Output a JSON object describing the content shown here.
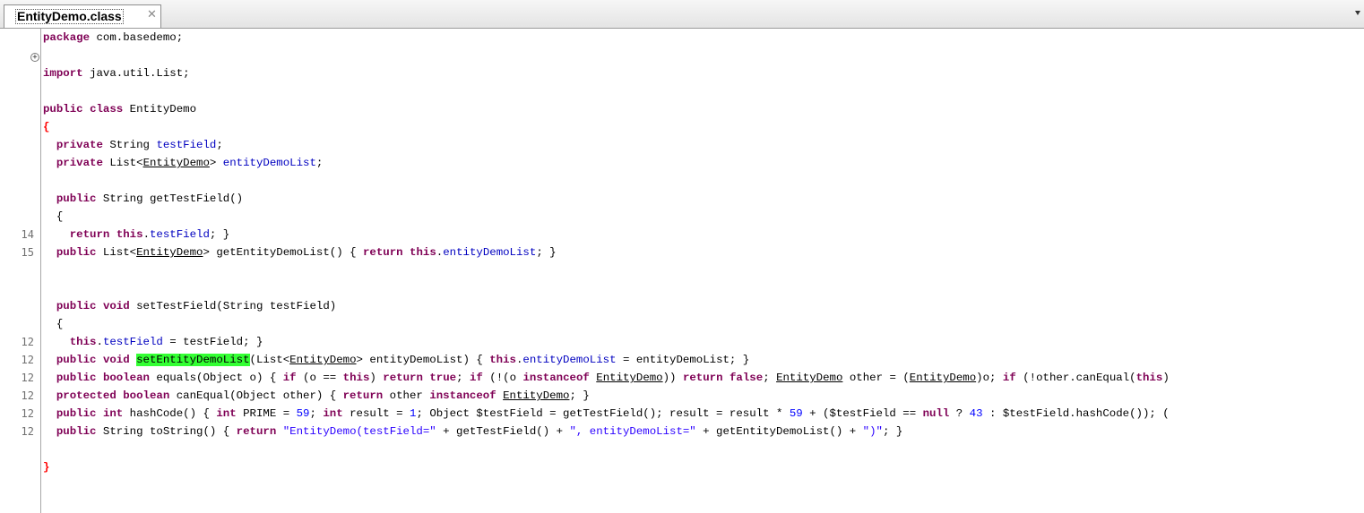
{
  "tab": {
    "title": "EntityDemo.class",
    "close_icon": "close-icon",
    "menu_icon": "dropdown-arrow-icon"
  },
  "gutter": {
    "line_numbers": [
      "14",
      "15",
      "12",
      "12",
      "12",
      "12",
      "12",
      "12"
    ]
  },
  "code": [
    [
      [
        "package",
        "kw"
      ],
      [
        " com.basedemo;",
        ""
      ]
    ],
    [],
    [
      [
        "import",
        "kw"
      ],
      [
        " java.util.List;",
        ""
      ]
    ],
    [],
    [
      [
        "public",
        "kw"
      ],
      [
        " ",
        ""
      ],
      [
        "class",
        "kw"
      ],
      [
        " EntityDemo",
        ""
      ]
    ],
    [
      [
        "{",
        "br"
      ]
    ],
    [
      [
        "  ",
        ""
      ],
      [
        "private",
        "kw"
      ],
      [
        " String ",
        ""
      ],
      [
        "testField",
        "fld"
      ],
      [
        ";",
        ""
      ]
    ],
    [
      [
        "  ",
        ""
      ],
      [
        "private",
        "kw"
      ],
      [
        " List<",
        ""
      ],
      [
        "EntityDemo",
        "ty"
      ],
      [
        "> ",
        ""
      ],
      [
        "entityDemoList",
        "fld"
      ],
      [
        ";",
        ""
      ]
    ],
    [],
    [
      [
        "  ",
        ""
      ],
      [
        "public",
        "kw"
      ],
      [
        " String getTestField()",
        ""
      ]
    ],
    [
      [
        "  {",
        ""
      ]
    ],
    [
      [
        "    ",
        ""
      ],
      [
        "return",
        "kw"
      ],
      [
        " ",
        ""
      ],
      [
        "this",
        "kw"
      ],
      [
        ".",
        ""
      ],
      [
        "testField",
        "fld"
      ],
      [
        "; }",
        ""
      ]
    ],
    [
      [
        "  ",
        ""
      ],
      [
        "public",
        "kw"
      ],
      [
        " List<",
        ""
      ],
      [
        "EntityDemo",
        "ty"
      ],
      [
        "> getEntityDemoList() { ",
        ""
      ],
      [
        "return",
        "kw"
      ],
      [
        " ",
        ""
      ],
      [
        "this",
        "kw"
      ],
      [
        ".",
        ""
      ],
      [
        "entityDemoList",
        "fld"
      ],
      [
        "; }",
        ""
      ]
    ],
    [],
    [],
    [
      [
        "  ",
        ""
      ],
      [
        "public",
        "kw"
      ],
      [
        " ",
        ""
      ],
      [
        "void",
        "kw"
      ],
      [
        " setTestField(String testField)",
        ""
      ]
    ],
    [
      [
        "  {",
        ""
      ]
    ],
    [
      [
        "    ",
        ""
      ],
      [
        "this",
        "kw"
      ],
      [
        ".",
        ""
      ],
      [
        "testField",
        "fld"
      ],
      [
        " = testField; }",
        ""
      ]
    ],
    [
      [
        "  ",
        ""
      ],
      [
        "public",
        "kw"
      ],
      [
        " ",
        ""
      ],
      [
        "void",
        "kw"
      ],
      [
        " ",
        ""
      ],
      [
        "setEntityDemoList",
        "hl"
      ],
      [
        "(List<",
        ""
      ],
      [
        "EntityDemo",
        "ty"
      ],
      [
        "> entityDemoList) { ",
        ""
      ],
      [
        "this",
        "kw"
      ],
      [
        ".",
        ""
      ],
      [
        "entityDemoList",
        "fld"
      ],
      [
        " = entityDemoList; }",
        ""
      ]
    ],
    [
      [
        "  ",
        ""
      ],
      [
        "public",
        "kw"
      ],
      [
        " ",
        ""
      ],
      [
        "boolean",
        "kw"
      ],
      [
        " equals(Object o) { ",
        ""
      ],
      [
        "if",
        "kw"
      ],
      [
        " (o == ",
        ""
      ],
      [
        "this",
        "kw"
      ],
      [
        ") ",
        ""
      ],
      [
        "return",
        "kw"
      ],
      [
        " ",
        ""
      ],
      [
        "true",
        "kw"
      ],
      [
        "; ",
        ""
      ],
      [
        "if",
        "kw"
      ],
      [
        " (!(o ",
        ""
      ],
      [
        "instanceof",
        "kw"
      ],
      [
        " ",
        ""
      ],
      [
        "EntityDemo",
        "ty"
      ],
      [
        ")) ",
        ""
      ],
      [
        "return",
        "kw"
      ],
      [
        " ",
        ""
      ],
      [
        "false",
        "kw"
      ],
      [
        "; ",
        ""
      ],
      [
        "EntityDemo",
        "ty"
      ],
      [
        " other = (",
        ""
      ],
      [
        "EntityDemo",
        "ty"
      ],
      [
        ")o; ",
        ""
      ],
      [
        "if",
        "kw"
      ],
      [
        " (!other.canEqual(",
        ""
      ],
      [
        "this",
        "kw"
      ],
      [
        ")",
        ""
      ]
    ],
    [
      [
        "  ",
        ""
      ],
      [
        "protected",
        "kw"
      ],
      [
        " ",
        ""
      ],
      [
        "boolean",
        "kw"
      ],
      [
        " canEqual(Object other) { ",
        ""
      ],
      [
        "return",
        "kw"
      ],
      [
        " other ",
        ""
      ],
      [
        "instanceof",
        "kw"
      ],
      [
        " ",
        ""
      ],
      [
        "EntityDemo",
        "ty"
      ],
      [
        "; }",
        ""
      ]
    ],
    [
      [
        "  ",
        ""
      ],
      [
        "public",
        "kw"
      ],
      [
        " ",
        ""
      ],
      [
        "int",
        "kw"
      ],
      [
        " hashCode() { ",
        ""
      ],
      [
        "int",
        "kw"
      ],
      [
        " PRIME = ",
        ""
      ],
      [
        "59",
        "num"
      ],
      [
        "; ",
        ""
      ],
      [
        "int",
        "kw"
      ],
      [
        " result = ",
        ""
      ],
      [
        "1",
        "num"
      ],
      [
        "; Object $testField = getTestField(); result = result * ",
        ""
      ],
      [
        "59",
        "num"
      ],
      [
        " + ($testField == ",
        ""
      ],
      [
        "null",
        "kw"
      ],
      [
        " ? ",
        ""
      ],
      [
        "43",
        "num"
      ],
      [
        " : $testField.hashCode()); (",
        ""
      ]
    ],
    [
      [
        "  ",
        ""
      ],
      [
        "public",
        "kw"
      ],
      [
        " String toString() { ",
        ""
      ],
      [
        "return",
        "kw"
      ],
      [
        " ",
        ""
      ],
      [
        "\"EntityDemo(testField=\"",
        "str"
      ],
      [
        " + getTestField() + ",
        ""
      ],
      [
        "\", entityDemoList=\"",
        "str"
      ],
      [
        " + getEntityDemoList() + ",
        ""
      ],
      [
        "\")\"",
        "str"
      ],
      [
        "; }",
        ""
      ]
    ],
    [],
    [
      [
        "}",
        "br"
      ]
    ]
  ]
}
